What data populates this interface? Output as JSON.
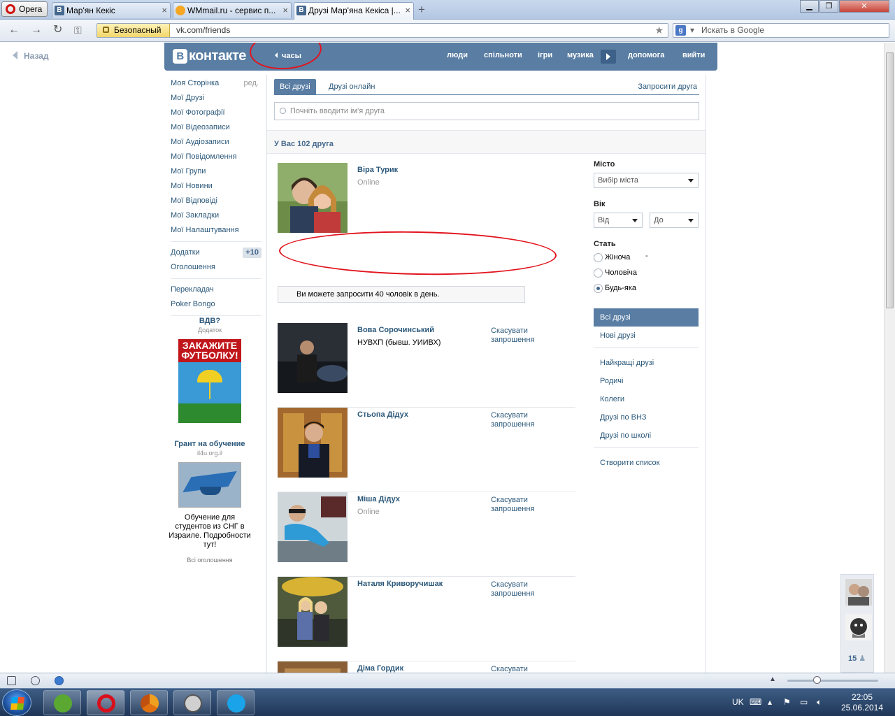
{
  "browser": {
    "menu_label": "Opera",
    "tabs": [
      {
        "title": "Мар'ян Кекіс"
      },
      {
        "title": "WMmail.ru - сервис п..."
      },
      {
        "title": "Друзі Мар'яна Кекіса |..."
      }
    ],
    "security_label": "Безопасный",
    "url": "vk.com/friends",
    "search_placeholder": "Искать в Google"
  },
  "page": {
    "back_label": "Назад",
    "header": {
      "logo_text": "контакте",
      "logo_letter": "B",
      "clock_label": "часы",
      "nav": [
        "люди",
        "спільноти",
        "ігри",
        "музика",
        "допомога",
        "вийти"
      ]
    },
    "left_menu": {
      "items": [
        "Моя Сторінка",
        "Мої Друзі",
        "Мої Фотографії",
        "Мої Відеозаписи",
        "Мої Аудіозаписи",
        "Мої Повідомлення",
        "Мої Групи",
        "Мої Новини",
        "Мої Відповіді",
        "Мої Закладки",
        "Мої Налаштування"
      ],
      "edit_label": "ред.",
      "apps_label": "Додатки",
      "apps_badge": "+10",
      "ads_label": "Оголошення",
      "extra": [
        "Перекладач",
        "Poker Bongo"
      ]
    },
    "ads": [
      {
        "title": "ВДВ?",
        "subtitle": "Додаток",
        "image_caption": "ЗАКАЖИТЕ ФУТБОЛКУ!"
      },
      {
        "title": "Грант на обучение",
        "subtitle": "il4u.org.il",
        "text": "Обучение для студентов из СНГ в Израиле. Подробности тут!"
      }
    ],
    "ads_all": "Всі оголошення",
    "friends": {
      "tabs": [
        "Всі друзі",
        "Друзі онлайн"
      ],
      "invite_label": "Запросити друга",
      "search_placeholder": "Почніть вводити ім'я друга",
      "count_label": "У Вас 102 друга",
      "notice": "Ви можете запросити 40 чоловік в день.",
      "cancel_label": "Скасувати запрошення",
      "list": [
        {
          "name": "Віра Турик",
          "status": "Online",
          "sub": "",
          "cancel": false
        },
        {
          "name": "Вова Сорочинський",
          "status": "",
          "sub": "НУВХП (бывш. УИИВХ)",
          "cancel": true
        },
        {
          "name": "Стьопа Дідух",
          "status": "",
          "sub": "",
          "cancel": true
        },
        {
          "name": "Міша Дідух",
          "status": "Online",
          "sub": "",
          "cancel": true
        },
        {
          "name": "Наталя Криворучишак",
          "status": "",
          "sub": "",
          "cancel": true
        },
        {
          "name": "Діма Гордик",
          "status": "",
          "sub": "",
          "cancel": true
        }
      ]
    },
    "filters": {
      "city_label": "Місто",
      "city_value": "Вибір міста",
      "age_label": "Вік",
      "age_from": "Від",
      "age_to": "До",
      "sex_label": "Стать",
      "sex_options": [
        "Жіноча",
        "Чоловіча",
        "Будь-яка"
      ],
      "sex_selected": "Будь-яка",
      "lists_primary": [
        "Всі друзі",
        "Нові друзі"
      ],
      "lists_secondary": [
        "Найкращі друзі",
        "Родичі",
        "Колеги",
        "Друзі по ВНЗ",
        "Друзі по школі"
      ],
      "create_list": "Створити список"
    },
    "chat": {
      "count": "15"
    }
  },
  "taskbar": {
    "lang": "UK",
    "time": "22:05",
    "date": "25.06.2014"
  },
  "colors": {
    "vk_blue": "#597da3",
    "link": "#2b587a",
    "annotation_red": "#e2141e"
  }
}
